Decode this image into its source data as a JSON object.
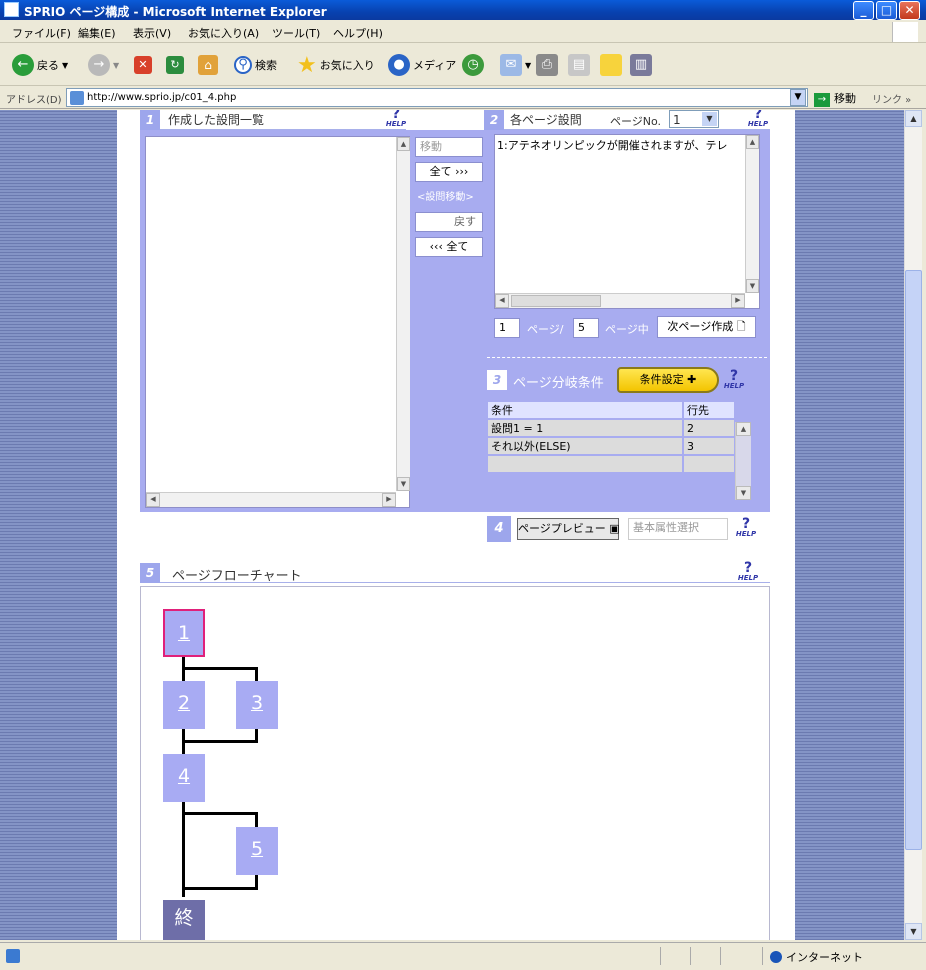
{
  "window": {
    "title": "SPRIO ページ構成 - Microsoft Internet Explorer"
  },
  "menu": [
    "ファイル(F)",
    "編集(E)",
    "表示(V)",
    "お気に入り(A)",
    "ツール(T)",
    "ヘルプ(H)"
  ],
  "toolbar": {
    "back": "戻る",
    "search": "検索",
    "favorites": "お気に入り",
    "media": "メディア"
  },
  "address": {
    "label": "アドレス(D)",
    "url": "http://www.sprio.jp/c01_4.php",
    "go": "移動",
    "links": "リンク"
  },
  "section1": {
    "num": "1",
    "title": "作成した設問一覧",
    "help": "HELP"
  },
  "move_controls": {
    "move": "移動",
    "all_right": "全て",
    "section_move": "<設問移動>",
    "back": "戻す",
    "all_left": "全て"
  },
  "section2": {
    "num": "2",
    "title": "各ページ設問",
    "page_no_label": "ページNo.",
    "page_no": "1",
    "help": "HELP",
    "list_items": [
      "1:アテネオリンピックが開催されますが、テレ"
    ]
  },
  "pagination": {
    "current": "1",
    "page_label": "ページ/",
    "total": "5",
    "page_mid_label": "ページ中",
    "next_button": "次ページ作成"
  },
  "section3": {
    "num": "3",
    "title": "ページ分岐条件",
    "button": "条件設定",
    "help": "HELP",
    "headers": [
      "条件",
      "行先"
    ],
    "rows": [
      [
        "設問1 = 1",
        "2"
      ],
      [
        "それ以外(ELSE)",
        "3"
      ],
      [
        "",
        ""
      ]
    ]
  },
  "section4": {
    "num": "4",
    "preview_button": "ページプレビュー",
    "basic_attr": "基本属性選択",
    "help": "HELP"
  },
  "section5": {
    "num": "5",
    "title": "ページフローチャート",
    "help": "HELP",
    "nodes": [
      "1",
      "2",
      "3",
      "4",
      "5",
      "終"
    ]
  },
  "status": {
    "zone": "インターネット"
  }
}
